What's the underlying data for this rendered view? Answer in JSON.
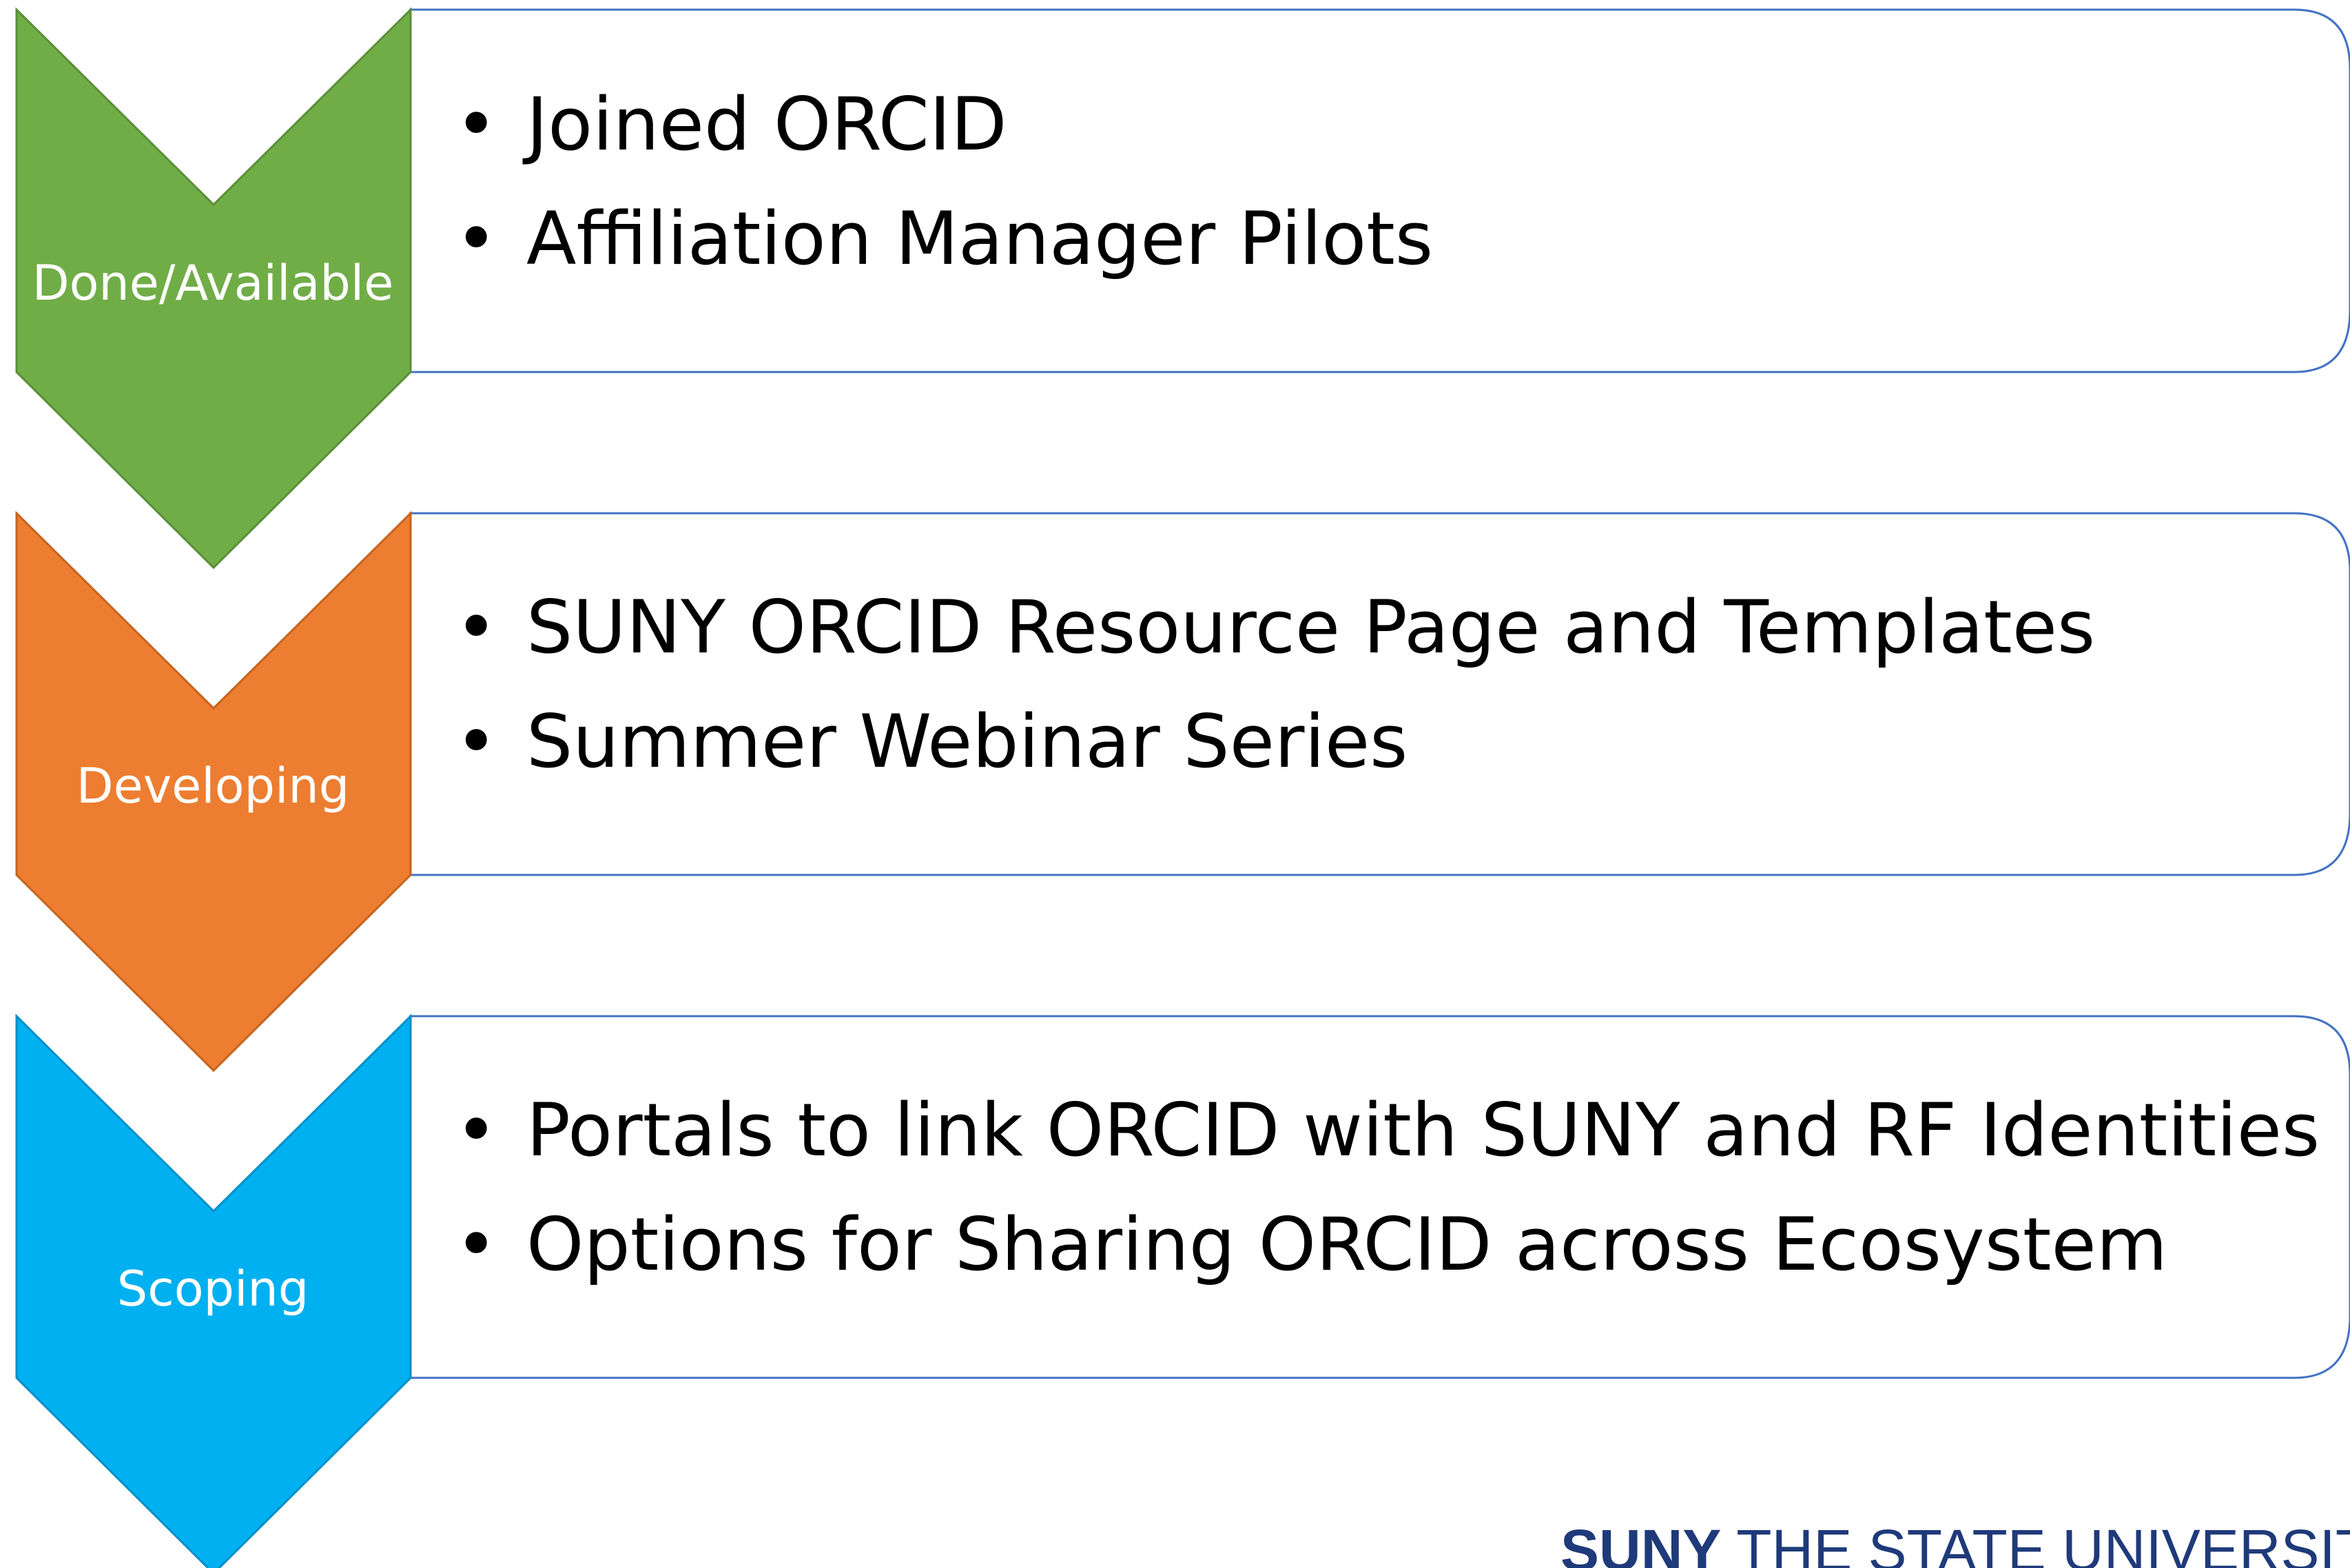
{
  "colors": {
    "done": "#70ad47",
    "developing": "#ed7d31",
    "scoping": "#00b0f0",
    "box_border": "#4472c4",
    "footer_text": "#1f3a7a"
  },
  "stages": [
    {
      "label": "Done/Available",
      "items": [
        "Joined ORCID",
        "Affiliation Manager Pilots"
      ]
    },
    {
      "label": "Developing",
      "items": [
        "SUNY ORCID Resource Page and Templates",
        "Summer Webinar Series"
      ]
    },
    {
      "label": "Scoping",
      "items": [
        "Portals to link ORCID with SUNY and RF Identities",
        "Options for Sharing ORCID across Ecosystem"
      ]
    }
  ],
  "footer": {
    "brand": "SUNY",
    "text": "THE STATE UNIVERSITY"
  }
}
